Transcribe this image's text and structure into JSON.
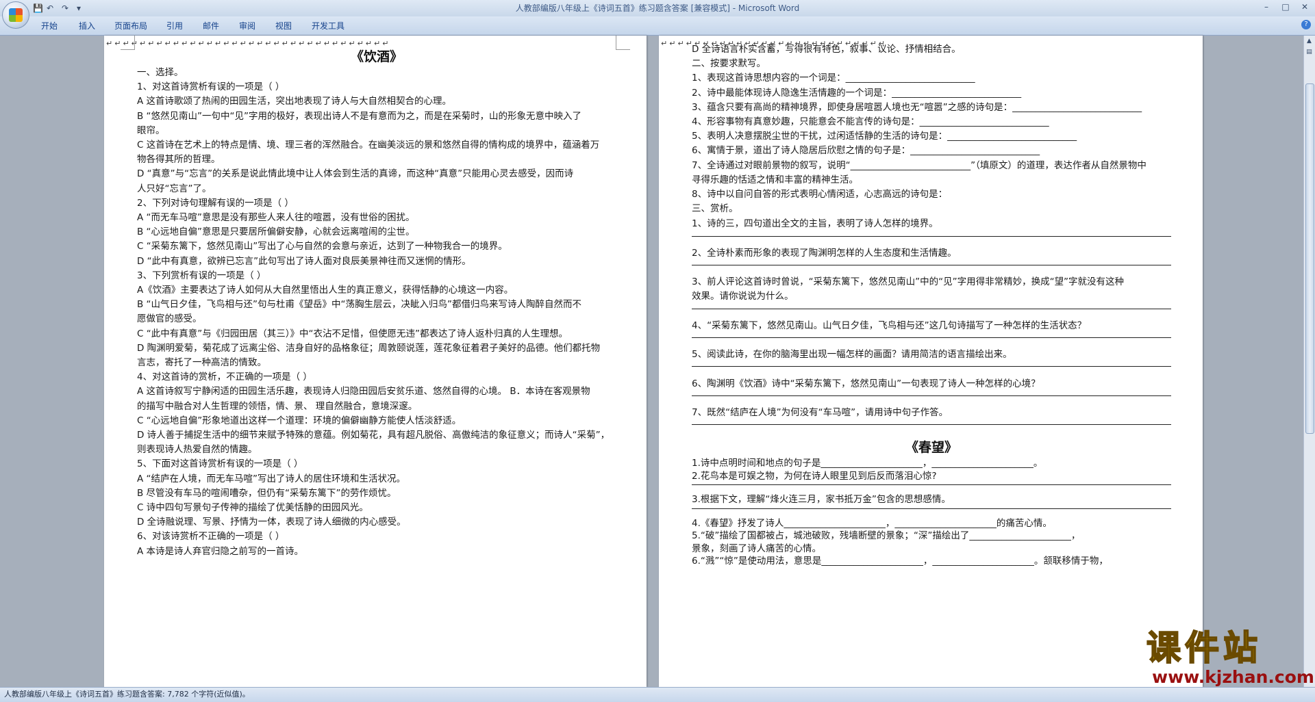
{
  "window": {
    "title": "人教部编版八年级上《诗词五首》练习题含答案 [兼容模式] - Microsoft Word",
    "controls": {
      "minimize": "–",
      "maximize": "□",
      "close": "✕"
    }
  },
  "ribbon": {
    "tabs": [
      "开始",
      "插入",
      "页面布局",
      "引用",
      "邮件",
      "审阅",
      "视图",
      "开发工具"
    ]
  },
  "status_bar": {
    "text": "人教部编版八年级上《诗词五首》练习题含答案: 7,782 个字符(近似值)。"
  },
  "watermark": {
    "text": "课件站",
    "url": "www.kjzhan.com"
  },
  "left_page": {
    "title": "《饮酒》",
    "lines": [
      "一、选择。",
      "1、对这首诗赏析有误的一项是（      ）",
      "A 这首诗歌颂了热闹的田园生活，突出地表现了诗人与大自然相契合的心理。",
      "B “悠然见南山”一句中“见”字用的极好，表现出诗人不是有意而为之，而是在采菊时，山的形象无意中映入了",
      "眼帘。",
      "C 这首诗在艺术上的特点是情、境、理三者的浑然融合。在幽美淡远的景和悠然自得的情构成的境界中，蕴涵着万",
      "物各得其所的哲理。",
      "D “真意”与“忘言”的关系是说此情此境中让人体会到生活的真谛，而这种“真意”只能用心灵去感受，因而诗",
      "人只好“忘言”了。",
      "2、下列对诗句理解有误的一项是（      ）",
      "A “而无车马喧”意思是没有那些人来人往的喧嚣，没有世俗的困扰。",
      "B “心远地自偏”意思是只要居所偏僻安静，心就会远离喧闹的尘世。",
      "C “采菊东篱下，悠然见南山”写出了心与自然的会意与亲近，达到了一种物我合一的境界。",
      "D “此中有真意，欲辨已忘言”此句写出了诗人面对良辰美景神往而又迷惘的情形。",
      "3、下列赏析有误的一项是（      ）",
      "A《饮酒》主要表达了诗人如何从大自然里悟出人生的真正意义，获得恬静的心境这一内容。",
      "B “山气日夕佳，飞鸟相与还”句与杜甫《望岳》中“荡胸生层云，决眦入归鸟”都借归鸟来写诗人陶醉自然而不",
      "愿做官的感受。",
      "C “此中有真意”与《归园田居（其三）》中“衣沾不足惜，但使愿无违”都表达了诗人返朴归真的人生理想。",
      "D 陶渊明爱菊，菊花成了远离尘俗、洁身自好的品格象征；周敦颐说莲，莲花象征着君子美好的品德。他们都托物",
      "言志，寄托了一种高洁的情致。",
      "4、对这首诗的赏析，不正确的一项是（      ）",
      "A 这首诗叙写宁静闲适的田园生活乐趣，表现诗人归隐田园后安贫乐道、悠然自得的心境。    B．本诗在客观景物",
      "的描写中融合对人生哲理的领悟，情、景、        理自然融合，意境深邃。",
      "C “心远地自偏”形象地道出这样一个道理：环境的偏僻幽静方能使人恬淡舒适。",
      "D 诗人善于捕捉生活中的细节来赋予特殊的意蕴。例如菊花，具有超凡脱俗、高傲纯洁的象征意义；而诗人“采菊”，",
      "则表现诗人热爱自然的情趣。",
      "5、下面对这首诗赏析有误的一项是（      ）",
      "A “结庐在人境，而无车马喧”写出了诗人的居住环境和生活状况。",
      "B 尽管没有车马的喧闹嘈杂，但仍有“采菊东篱下”的劳作烦忧。",
      "C 诗中四句写景句子传神的描绘了优美恬静的田园风光。",
      "D 全诗融说理、写景、抒情为一体，表现了诗人细微的内心感受。",
      "6、对该诗赏析不正确的一项是（      ）",
      "A 本诗是诗人弃官归隐之前写的一首诗。"
    ]
  },
  "right_page": {
    "top_lines": [
      "D 全诗语言朴实含蓄，写得很有特色，叙事、议论、抒情相结合。",
      "二、按要求默写。",
      "1、表现这首诗思想内容的一个词是：____________________________",
      "2、诗中最能体现诗人隐逸生活情趣的一个词是：____________________________",
      "3、蕴含只要有高尚的精神境界，即使身居喧嚣人境也无“喧嚣”之感的诗句是：____________________________",
      "4、形容事物有真意妙趣，只能意会不能言传的诗句是：____________________________",
      "5、表明人决意摆脱尘世的干扰，过闲适恬静的生活的诗句是：____________________________",
      "6、寓情于景，道出了诗人隐居后欣慰之情的句子是：____________________________",
      "7、全诗通过对眼前景物的叙写，说明“__________________________”（填原文）的道理，表达作者从自然景物中",
      "寻得乐趣的恬适之情和丰富的精神生活。",
      "8、诗中以自问自答的形式表明心情闲适，心志高远的诗句是：",
      "三、赏析。"
    ],
    "questions": [
      {
        "lines": [
          "1、诗的三，四句道出全文的主旨，表明了诗人怎样的境界。"
        ]
      },
      {
        "lines": [
          "2、全诗朴素而形象的表现了陶渊明怎样的人生态度和生活情趣。"
        ]
      },
      {
        "lines": [
          "3、前人评论这首诗时曾说，“采菊东篱下，悠然见南山”中的“见”字用得非常精妙，换成“望”字就没有这种",
          "效果。请你说说为什么。"
        ]
      },
      {
        "lines": [
          "4、“采菊东篱下，悠然见南山。山气日夕佳，飞鸟相与还”这几句诗描写了一种怎样的生活状态？"
        ]
      },
      {
        "lines": [
          "5、阅读此诗，在你的脑海里出现一幅怎样的画面？请用简洁的语言描绘出来。"
        ]
      },
      {
        "lines": [
          "6、陶渊明《饮酒》诗中“采菊东篱下，悠然见南山”一句表现了诗人一种怎样的心境？"
        ]
      },
      {
        "lines": [
          "7、既然“结庐在人境”为何没有“车马喧”，请用诗中句子作答。"
        ]
      }
    ],
    "title2": "《春望》",
    "chunwang_lines": [
      "1.诗中点明时间和地点的句子是______________________，______________________。",
      "2.花鸟本是可娱之物，为何在诗人眼里见到后反而落泪心惊?",
      "3.根据下文，理解“烽火连三月，家书抵万金”包含的思想感情。",
      "4.《春望》抒发了诗人______________________，______________________的痛苦心情。",
      "5.“破”描绘了国都被占，城池破败，残墙断壁的景象；“深”描绘出了______________________，",
      "景象，刻画了诗人痛苦的心情。",
      "6.“溅”“惊”是使动用法，意思是______________________，______________________。颔联移情于物，"
    ]
  }
}
